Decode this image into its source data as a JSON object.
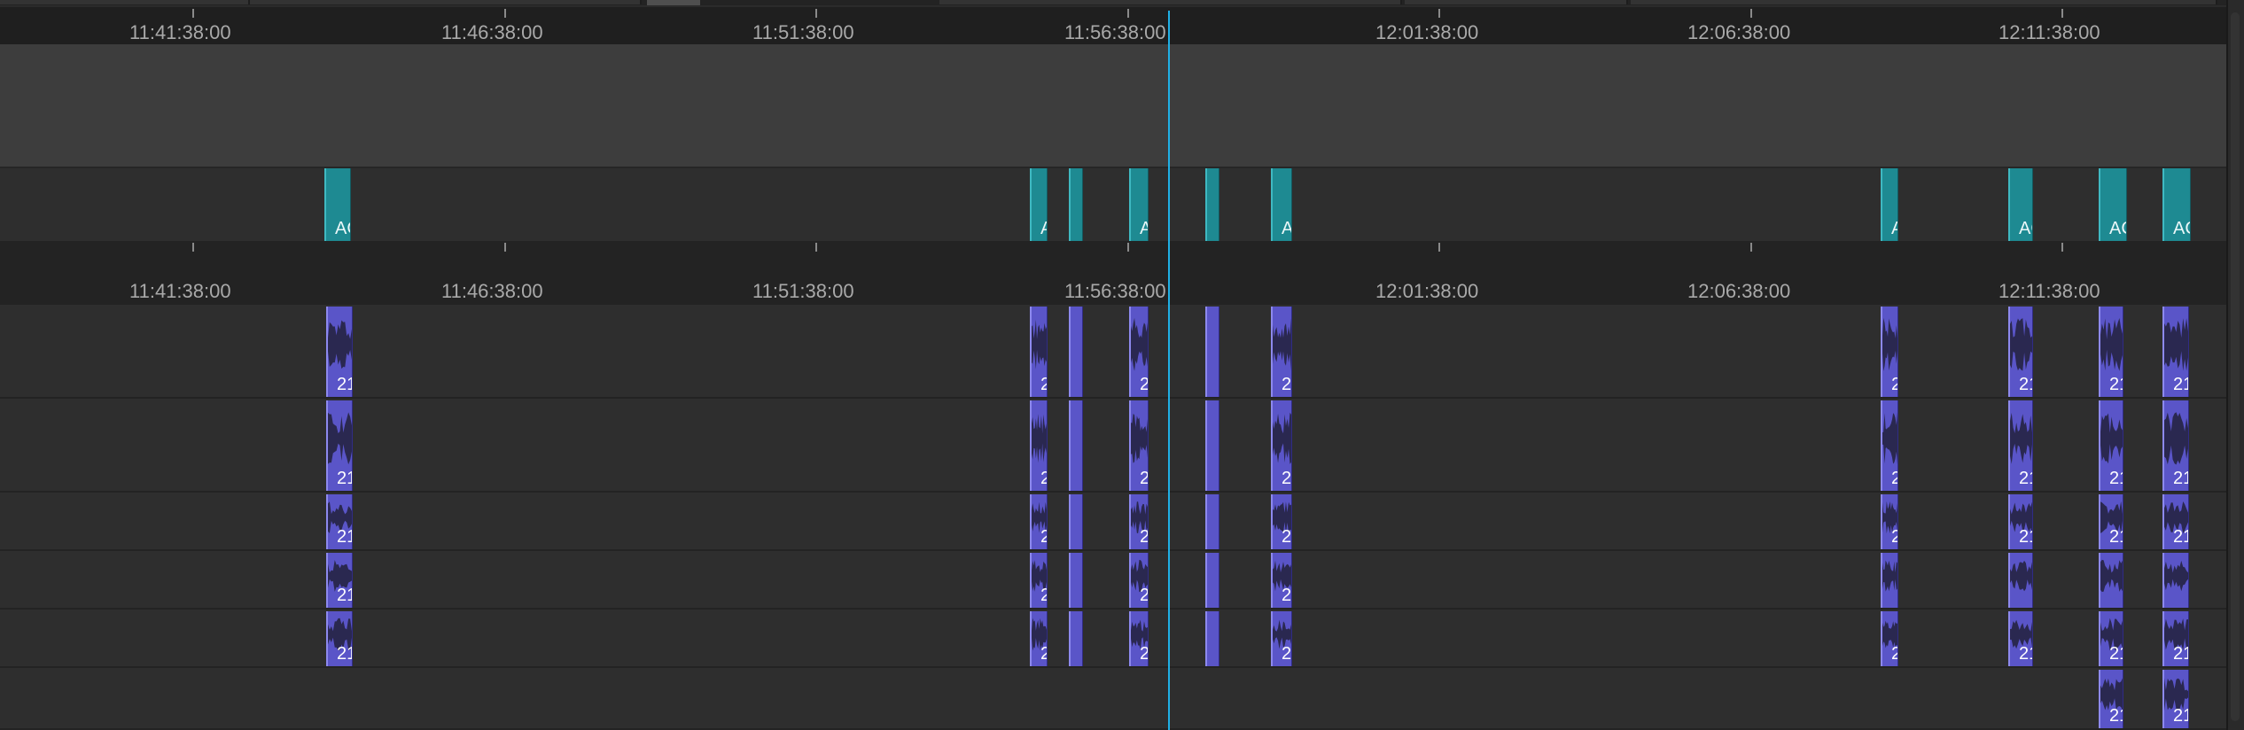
{
  "timeline": {
    "timecodes": [
      "11:41:38:00",
      "11:46:38:00",
      "11:51:38:00",
      "11:56:38:00",
      "12:01:38:00",
      "12:06:38:00",
      "12:11:38:00"
    ],
    "video_clip_labels": [
      "AC",
      "A",
      "",
      "A",
      "",
      "A",
      "A",
      "AC",
      "AC",
      "AC"
    ],
    "audio_tracks": [
      {
        "clip_labels": [
          "21",
          "2",
          "",
          "2",
          "",
          "2",
          "2",
          "21",
          "21",
          "21"
        ]
      },
      {
        "clip_labels": [
          "21",
          "2",
          "",
          "2",
          "",
          "2",
          "2",
          "21",
          "21",
          "21"
        ]
      },
      {
        "clip_labels": [
          "21",
          "2",
          "",
          "2",
          "",
          "2",
          "2",
          "21",
          "21",
          "21"
        ]
      },
      {
        "clip_labels": [
          "21",
          "2",
          "",
          "2",
          "",
          "2",
          "",
          "",
          "",
          ""
        ]
      },
      {
        "clip_labels": [
          "21",
          "2",
          "",
          "2",
          "",
          "2",
          "2",
          "21",
          "21",
          "21"
        ]
      },
      {
        "clip_labels": [
          "21",
          "21"
        ]
      }
    ],
    "colors": {
      "video_clip": "#1e8a92",
      "audio_clip": "#5a55c8",
      "playhead": "#1fb0e6",
      "ruler_bg": "#1f1f1f",
      "track_bg": "#2e2e2e"
    },
    "icons": {
      "playhead": "playhead-line",
      "waveform": "audio-waveform-icon"
    }
  }
}
